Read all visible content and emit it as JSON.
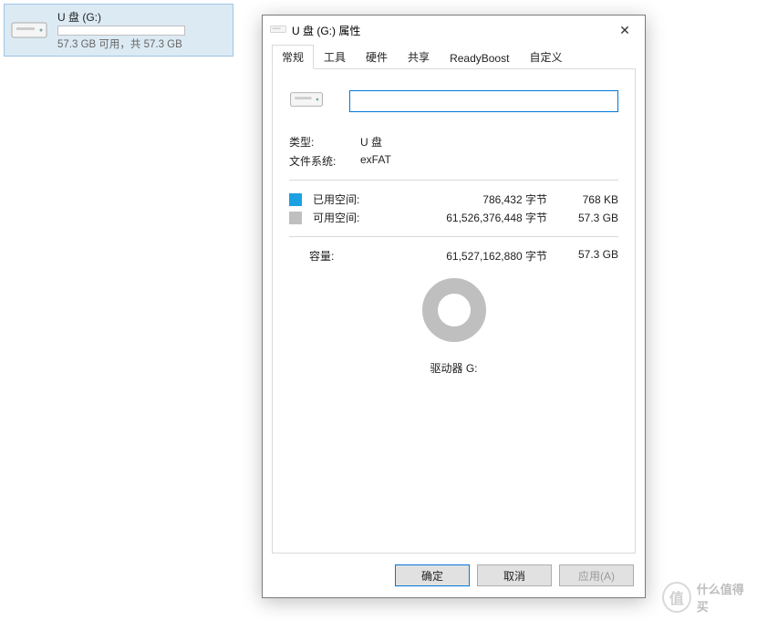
{
  "drive_tile": {
    "name": "U 盘 (G:)",
    "subtitle": "57.3 GB 可用，共 57.3 GB"
  },
  "dialog": {
    "title": "U 盘 (G:) 属性",
    "tabs": [
      "常规",
      "工具",
      "硬件",
      "共享",
      "ReadyBoost",
      "自定义"
    ],
    "name_value": "",
    "type_label": "类型:",
    "type_value": "U 盘",
    "fs_label": "文件系统:",
    "fs_value": "exFAT",
    "used": {
      "label": "已用空间:",
      "bytes": "786,432 字节",
      "hr": "768 KB",
      "color": "#1ba1e2"
    },
    "free": {
      "label": "可用空间:",
      "bytes": "61,526,376,448 字节",
      "hr": "57.3 GB",
      "color": "#bfbfbf"
    },
    "capacity": {
      "label": "容量:",
      "bytes": "61,527,162,880 字节",
      "hr": "57.3 GB"
    },
    "drive_label": "驱动器 G:",
    "buttons": {
      "ok": "确定",
      "cancel": "取消",
      "apply": "应用(A)"
    }
  },
  "watermark": "什么值得买"
}
